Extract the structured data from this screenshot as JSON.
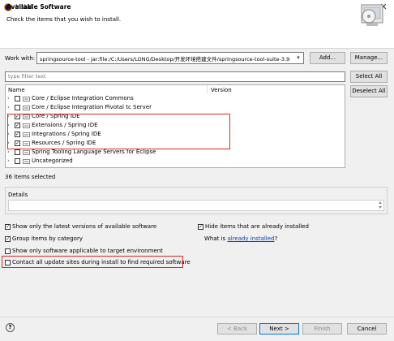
{
  "window": {
    "title": "Install",
    "close_glyph": "✕"
  },
  "header": {
    "title": "Available Software",
    "description": "Check the items that you wish to install."
  },
  "work_with": {
    "label": "Work with:",
    "value": "springsource-tool - jar:file:/C:/Users/LONG/Desktop/开发环境搭建文件/springsource-tool-suite-3.9",
    "add_button": "Add...",
    "manage_button": "Manage..."
  },
  "filter": {
    "placeholder": "type filter text"
  },
  "buttons": {
    "select_all": "Select All",
    "deselect_all": "Deselect All"
  },
  "tree": {
    "columns": {
      "name": "Name",
      "version": "Version"
    },
    "rows": [
      {
        "label": "Core / Eclipse Integration Commons",
        "checked": false
      },
      {
        "label": "Core / Eclipse Integration Pivotal tc Server",
        "checked": false
      },
      {
        "label": "Core / Spring IDE",
        "checked": true
      },
      {
        "label": "Extensions / Spring IDE",
        "checked": true
      },
      {
        "label": "Integrations / Spring IDE",
        "checked": true
      },
      {
        "label": "Resources / Spring IDE",
        "checked": true
      },
      {
        "label": "Spring Tooling Language Servers for Eclipse",
        "checked": false
      },
      {
        "label": "Uncategorized",
        "checked": false
      }
    ]
  },
  "status": {
    "items_selected": "36 items selected"
  },
  "details": {
    "label": "Details"
  },
  "options": {
    "show_latest": {
      "label": "Show only the latest versions of available software",
      "checked": true
    },
    "hide_installed": {
      "label": "Hide items that are already installed",
      "checked": true
    },
    "group_by_category": {
      "label": "Group items by category",
      "checked": true
    },
    "what_is_prefix": "What is ",
    "what_is_link": "already installed",
    "what_is_suffix": "?",
    "show_applicable": {
      "label": "Show only software applicable to target environment",
      "checked": false
    },
    "contact_all": {
      "label": "Contact all update sites during install to find required software",
      "checked": false
    }
  },
  "footer": {
    "help_glyph": "?",
    "back": "< Back",
    "next": "Next >",
    "finish": "Finish",
    "cancel": "Cancel"
  },
  "colors": {
    "highlight_box": "#d9272a",
    "link": "#0645ad",
    "accent_border": "#0078d7"
  }
}
